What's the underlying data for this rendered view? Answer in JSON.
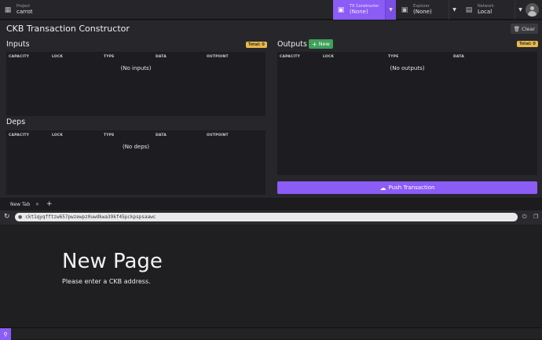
{
  "topbar": {
    "project": {
      "label": "Project",
      "value": "carrot",
      "icon": "folder-icon"
    },
    "tx_constructor": {
      "label": "TX Constructor",
      "value": "(None)",
      "icon": "document-icon"
    },
    "explorer": {
      "label": "Explorer",
      "value": "(None)",
      "icon": "document-icon"
    },
    "network": {
      "label": "Network",
      "value": "Local",
      "icon": "monitor-icon"
    }
  },
  "page": {
    "title": "CKB Transaction Constructor",
    "clear_label": "Clear",
    "push_label": "Push Transaction"
  },
  "inputs": {
    "title": "Inputs",
    "total": "Total: 0",
    "columns": [
      "CAPACITY",
      "LOCK",
      "TYPE",
      "DATA",
      "OUTPOINT"
    ],
    "empty": "(No inputs)"
  },
  "deps": {
    "title": "Deps",
    "columns": [
      "CAPACITY",
      "LOCK",
      "TYPE",
      "DATA",
      "OUTPOINT"
    ],
    "empty": "(No deps)"
  },
  "outputs": {
    "title": "Outputs",
    "new_label": "New",
    "total": "Total: 0",
    "columns": [
      "CAPACITY",
      "LOCK",
      "TYPE",
      "DATA"
    ],
    "empty": "(No outputs)"
  },
  "browser": {
    "tab_label": "New Tab",
    "address": "ckt1qyqfftzw657pwzewpz0uwdkwa39kf45pckpspsaawc"
  },
  "newpage": {
    "title": "New Page",
    "subtitle": "Please enter a CKB address."
  },
  "colors": {
    "accent": "#8b5cf6",
    "success": "#3fa05a",
    "badge": "#e9b949"
  }
}
